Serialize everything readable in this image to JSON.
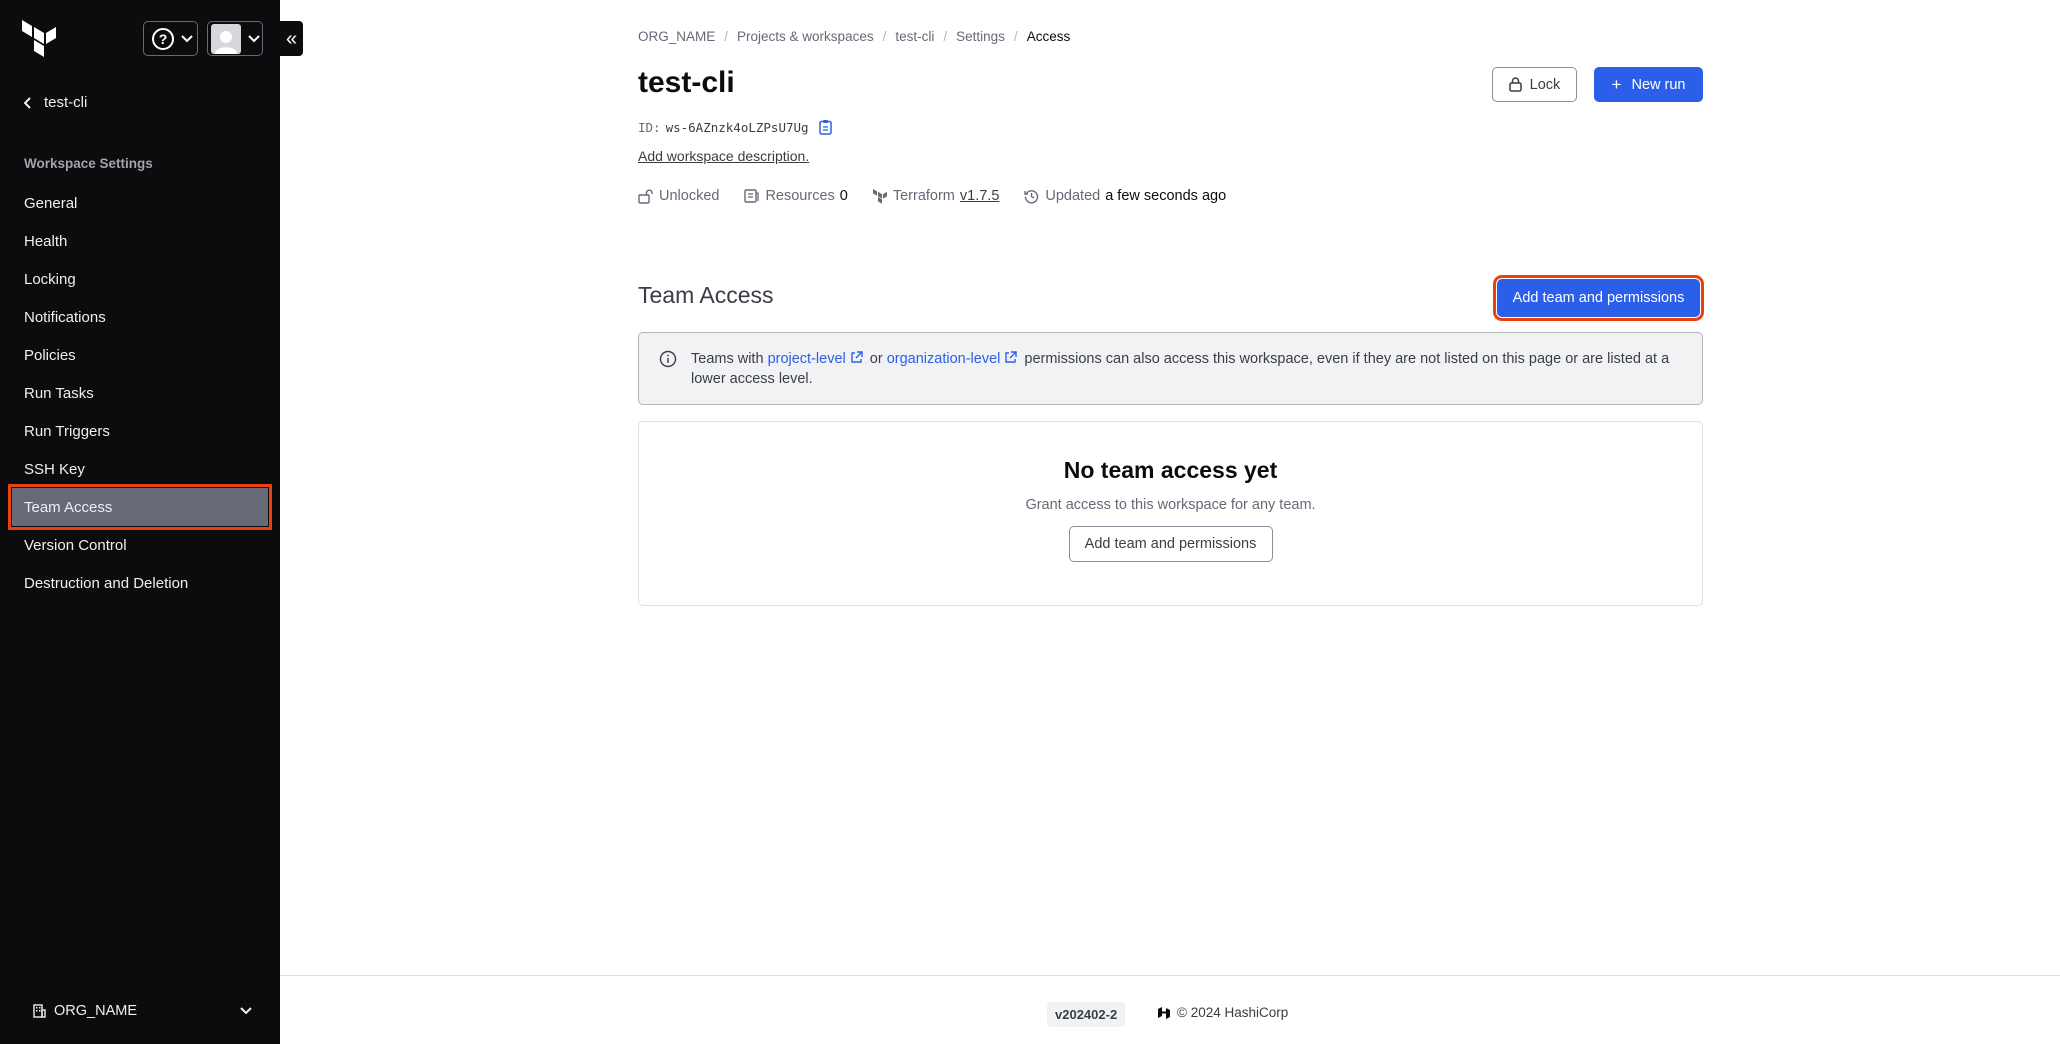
{
  "sidebar": {
    "back_label": "test-cli",
    "section_heading": "Workspace Settings",
    "items": [
      {
        "label": "General"
      },
      {
        "label": "Health"
      },
      {
        "label": "Locking"
      },
      {
        "label": "Notifications"
      },
      {
        "label": "Policies"
      },
      {
        "label": "Run Tasks"
      },
      {
        "label": "Run Triggers"
      },
      {
        "label": "SSH Key"
      },
      {
        "label": "Team Access"
      },
      {
        "label": "Version Control"
      },
      {
        "label": "Destruction and Deletion"
      }
    ],
    "active_item": "Team Access",
    "org_name": "ORG_NAME",
    "help_icon_glyph": "?",
    "collapse_glyph": "«"
  },
  "breadcrumb": [
    "ORG_NAME",
    "Projects & workspaces",
    "test-cli",
    "Settings",
    "Access"
  ],
  "workspace": {
    "title": "test-cli",
    "id_label": "ID:",
    "id_value": "ws-6AZnzk4oLZPsU7Ug",
    "description_link": "Add workspace description.",
    "lock_label": "Lock",
    "new_run_label": "New run",
    "meta": {
      "lock_status": "Unlocked",
      "resources_label": "Resources",
      "resources_count": "0",
      "terraform_label": "Terraform",
      "terraform_version": "v1.7.5",
      "updated_label": "Updated",
      "updated_value": "a few seconds ago"
    }
  },
  "team_access": {
    "title": "Team Access",
    "add_button": "Add team and permissions",
    "info": {
      "prefix": "Teams with",
      "link1": "project-level",
      "middle": "or",
      "link2": "organization-level",
      "suffix": "permissions can also access this workspace, even if they are not listed on this page or are listed at a lower access level."
    },
    "empty": {
      "title": "No team access yet",
      "subtitle": "Grant access to this workspace for any team.",
      "button": "Add team and permissions"
    }
  },
  "footer": {
    "version": "v202402-2",
    "copyright": "© 2024 HashiCorp"
  },
  "colors": {
    "sidebar_bg": "#0c0c0e",
    "primary": "#2b5fe9",
    "highlight": "#e8410d",
    "active_nav": "#656a76"
  }
}
